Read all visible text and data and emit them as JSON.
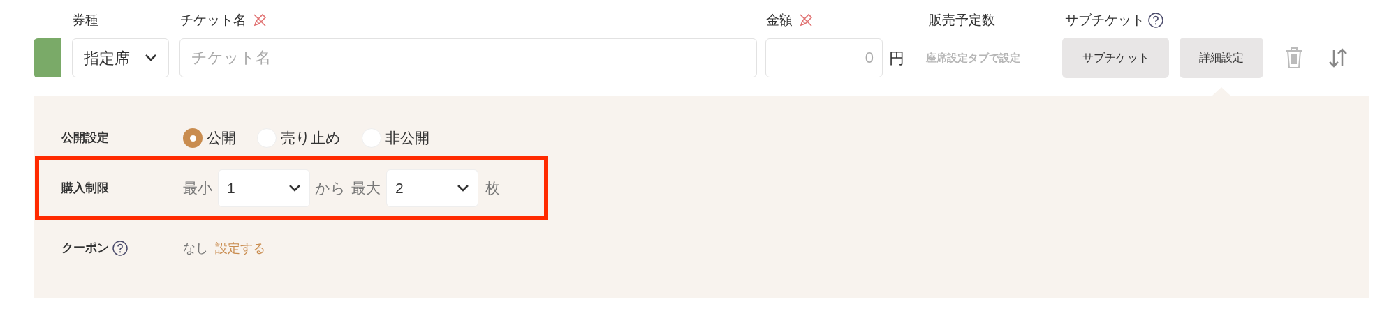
{
  "ticket_row": {
    "color": "#7aaa68",
    "headers": [
      {
        "label": "券種",
        "kind": "plain"
      },
      {
        "label": "チケット名",
        "kind": "required"
      },
      {
        "label": "金額",
        "kind": "required"
      },
      {
        "label": "販売予定数",
        "kind": "plain"
      },
      {
        "label": "サブチケット",
        "kind": "help"
      }
    ],
    "type_select": {
      "value": "指定席"
    },
    "name_field": {
      "placeholder": "チケット名"
    },
    "amount_field": {
      "placeholder": "0",
      "unit": "円"
    },
    "sales_note": "座席設定タブで設定",
    "buttons": [
      {
        "label": "サブチケット",
        "selected": false
      },
      {
        "label": "詳細設定",
        "selected": true
      }
    ]
  },
  "detail_panel": {
    "visibility": {
      "label": "公開設定",
      "options": [
        {
          "label": "公開",
          "selected": true
        },
        {
          "label": "売り止め",
          "selected": false
        },
        {
          "label": "非公開",
          "selected": false
        }
      ]
    },
    "purchase_limit": {
      "label": "購入制限",
      "highlighted": true,
      "min_label": "最小",
      "min_value": "1",
      "between": "から",
      "max_label": "最大",
      "max_value": "2",
      "unit": "枚"
    },
    "coupon": {
      "label": "クーポン",
      "value": "なし",
      "link": "設定する"
    }
  }
}
